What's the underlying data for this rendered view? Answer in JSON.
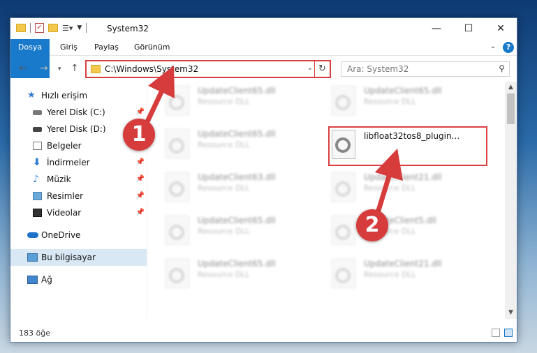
{
  "window": {
    "title": "System32",
    "controls": {
      "minimize": "—",
      "maximize": "☐",
      "close": "✕"
    }
  },
  "ribbon": {
    "file_tab": "Dosya",
    "tabs": [
      "Giriş",
      "Paylaş",
      "Görünüm"
    ],
    "help": "?"
  },
  "navigation": {
    "address": "C:\\Windows\\System32",
    "search_placeholder": "Ara: System32"
  },
  "sidebar": {
    "items": [
      {
        "label": "Hızlı erişim",
        "icon": "star-icon"
      },
      {
        "label": "Yerel Disk (C:)",
        "icon": "drive-icon",
        "pinned": true
      },
      {
        "label": "Yerel Disk (D:)",
        "icon": "drive-icon"
      },
      {
        "label": "Belgeler",
        "icon": "documents-icon",
        "pinned": true
      },
      {
        "label": "İndirmeler",
        "icon": "download-icon",
        "pinned": true
      },
      {
        "label": "Müzik",
        "icon": "music-icon",
        "pinned": true
      },
      {
        "label": "Resimler",
        "icon": "pictures-icon",
        "pinned": true
      },
      {
        "label": "Videolar",
        "icon": "videos-icon",
        "pinned": true
      },
      {
        "label": "OneDrive",
        "icon": "onedrive-icon"
      },
      {
        "label": "Bu bilgisayar",
        "icon": "computer-icon",
        "selected": true
      },
      {
        "label": "Ağ",
        "icon": "network-icon"
      }
    ]
  },
  "files": {
    "blurred": [
      {
        "name": "UpdateClient65.dll",
        "type": "Resource DLL"
      },
      {
        "name": "UpdateClient65.dll",
        "type": "Resource DLL"
      },
      {
        "name": "UpdateClient65.dll",
        "type": "Resource DLL"
      },
      {
        "name": "UpdateClient63.dll",
        "type": "Resource DLL"
      },
      {
        "name": "UpdateClient21.dll",
        "type": "Resource DLL"
      },
      {
        "name": "UpdateClient65.dll",
        "type": "Resource DLL"
      },
      {
        "name": "UpdateClient5.dll",
        "type": "Resource DLL"
      },
      {
        "name": "UpdateClient65.dll",
        "type": "Resource DLL"
      },
      {
        "name": "UpdateClient21.dll",
        "type": "Resource DLL"
      }
    ],
    "highlighted": {
      "name": "libfloat32tos8_plugin..."
    }
  },
  "status": {
    "count": "183 öğe"
  },
  "annotations": {
    "step1": "1",
    "step2": "2",
    "accent": "#d73c3c"
  }
}
